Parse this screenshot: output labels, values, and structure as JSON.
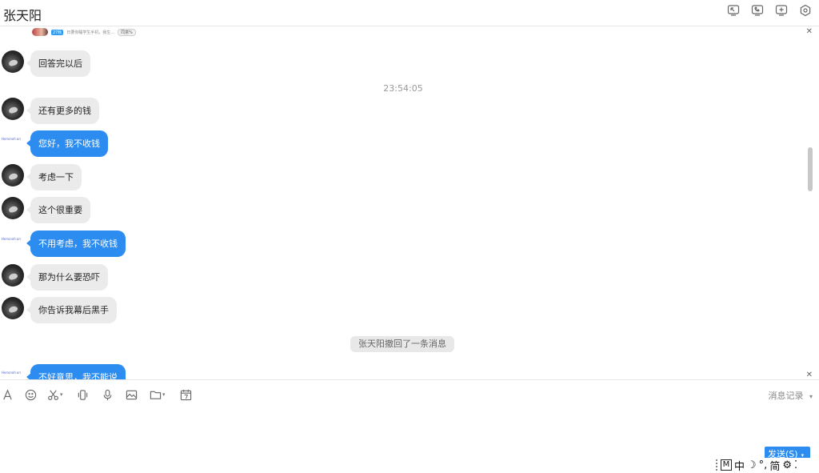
{
  "window": {
    "title": "张天阳"
  },
  "header_icons": [
    "share-screen-icon",
    "phone-icon",
    "add-icon",
    "settings-icon"
  ],
  "history_strip": {
    "tag": "27秋",
    "text": "日要你睡学生手机，我生...",
    "button": "同意%"
  },
  "messages": [
    {
      "side": "in",
      "text": "回答完以后"
    },
    {
      "side": "in",
      "text": "还有更多的钱"
    },
    {
      "side": "out",
      "text": "您好，我不收钱"
    },
    {
      "side": "in",
      "text": "考虑一下"
    },
    {
      "side": "in",
      "text": "这个很重要"
    },
    {
      "side": "out",
      "text": "不用考虑，我不收钱"
    },
    {
      "side": "in",
      "text": "那为什么要恐吓"
    },
    {
      "side": "in",
      "text": "你告诉我幕后黑手"
    },
    {
      "side": "out",
      "text": "不好意思，我不能说"
    }
  ],
  "timestamp": "23:54:05",
  "recall_notice": "张天阳撤回了一条消息",
  "self_avatar_text": "Hensnoh.on",
  "toolbar": {
    "items": [
      "font-icon",
      "emoji-icon",
      "scissors-icon",
      "shake-icon",
      "mic-icon",
      "image-icon",
      "folder-icon",
      "calendar-icon"
    ],
    "history_label": "消息记录",
    "history_caret": "▾"
  },
  "send_button": {
    "label": "发送(S)",
    "caret": "▾"
  },
  "ime": {
    "mode_box": "M",
    "lang": "中",
    "moon": "☽",
    "punct": "°,",
    "simp": "简",
    "gear": "⚙",
    "more": "⁚"
  },
  "colors": {
    "accent": "#2d8cf0",
    "bubble_in": "#ebebeb"
  }
}
